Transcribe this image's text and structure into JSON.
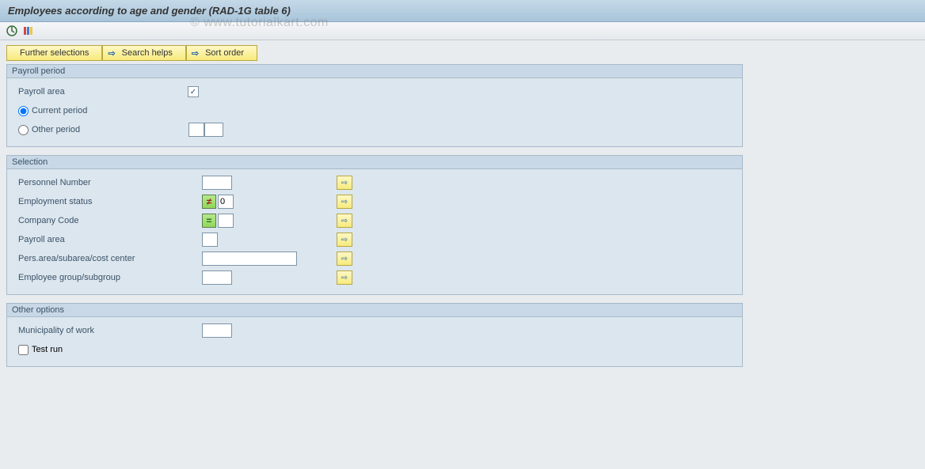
{
  "header": {
    "title": "Employees according to age and gender (RAD-1G table 6)"
  },
  "watermark": "© www.tutorialkart.com",
  "toolbar_buttons": {
    "further_selections": "Further selections",
    "search_helps": "Search helps",
    "sort_order": "Sort order"
  },
  "payroll_period": {
    "legend": "Payroll period",
    "payroll_area_label": "Payroll area",
    "payroll_area_checked": "✓",
    "current_period_label": "Current period",
    "other_period_label": "Other period",
    "other_period_val1": "",
    "other_period_val2": ""
  },
  "selection": {
    "legend": "Selection",
    "personnel_number_label": "Personnel Number",
    "personnel_number_value": "",
    "employment_status_label": "Employment status",
    "employment_status_indicator": "≠",
    "employment_status_value": "0",
    "company_code_label": "Company Code",
    "company_code_indicator": "=",
    "company_code_value": "",
    "payroll_area_label": "Payroll area",
    "payroll_area_value": "",
    "pers_area_label": "Pers.area/subarea/cost center",
    "pers_area_value": "",
    "employee_group_label": "Employee group/subgroup",
    "employee_group_value": ""
  },
  "other_options": {
    "legend": "Other options",
    "municipality_label": "Municipality of work",
    "municipality_value": "",
    "test_run_label": "Test run"
  }
}
